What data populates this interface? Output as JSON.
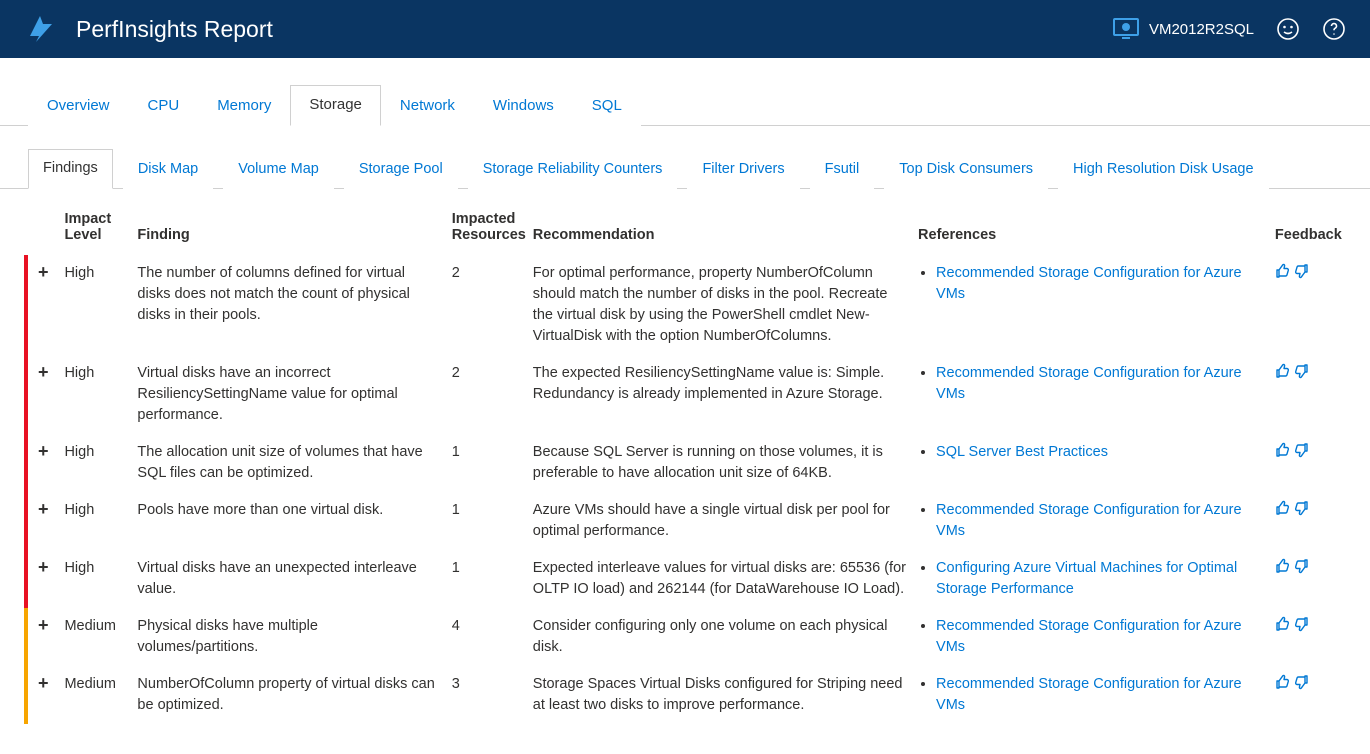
{
  "header": {
    "title": "PerfInsights Report",
    "vm_name": "VM2012R2SQL"
  },
  "tabs": {
    "main": [
      "Overview",
      "CPU",
      "Memory",
      "Storage",
      "Network",
      "Windows",
      "SQL"
    ],
    "main_active": 3,
    "sub": [
      "Findings",
      "Disk Map",
      "Volume Map",
      "Storage Pool",
      "Storage Reliability Counters",
      "Filter Drivers",
      "Fsutil",
      "Top Disk Consumers",
      "High Resolution Disk Usage"
    ],
    "sub_active": 0
  },
  "columns": {
    "impact": "Impact Level",
    "finding": "Finding",
    "resources": "Impacted Resources",
    "recommendation": "Recommendation",
    "references": "References",
    "feedback": "Feedback"
  },
  "findings": [
    {
      "impact": "High",
      "finding": "The number of columns defined for virtual disks does not match the count of physical disks in their pools.",
      "resources": "2",
      "recommendation": "For optimal performance, property NumberOfColumn should match the number of disks in the pool. Recreate the virtual disk by using the PowerShell cmdlet New-VirtualDisk with the option NumberOfColumns.",
      "references": [
        "Recommended Storage Configuration for Azure VMs"
      ]
    },
    {
      "impact": "High",
      "finding": "Virtual disks have an incorrect ResiliencySettingName value for optimal performance.",
      "resources": "2",
      "recommendation": "The expected ResiliencySettingName value is: Simple. Redundancy is already implemented in Azure Storage.",
      "references": [
        "Recommended Storage Configuration for Azure VMs"
      ]
    },
    {
      "impact": "High",
      "finding": "The allocation unit size of volumes that have SQL files can be optimized.",
      "resources": "1",
      "recommendation": "Because SQL Server is running on those volumes, it is preferable to have allocation unit size of 64KB.",
      "references": [
        "SQL Server Best Practices"
      ]
    },
    {
      "impact": "High",
      "finding": "Pools have more than one virtual disk.",
      "resources": "1",
      "recommendation": "Azure VMs should have a single virtual disk per pool for optimal performance.",
      "references": [
        "Recommended Storage Configuration for Azure VMs"
      ]
    },
    {
      "impact": "High",
      "finding": "Virtual disks have an unexpected interleave value.",
      "resources": "1",
      "recommendation": "Expected interleave values for virtual disks are: 65536 (for OLTP IO load) and 262144 (for DataWarehouse IO Load).",
      "references": [
        "Configuring Azure Virtual Machines for Optimal Storage Performance"
      ]
    },
    {
      "impact": "Medium",
      "finding": "Physical disks have multiple volumes/partitions.",
      "resources": "4",
      "recommendation": "Consider configuring only one volume on each physical disk.",
      "references": [
        "Recommended Storage Configuration for Azure VMs"
      ]
    },
    {
      "impact": "Medium",
      "finding": "NumberOfColumn property of virtual disks can be optimized.",
      "resources": "3",
      "recommendation": "Storage Spaces Virtual Disks configured for Striping need at least two disks to improve performance.",
      "references": [
        "Recommended Storage Configuration for Azure VMs"
      ]
    }
  ]
}
